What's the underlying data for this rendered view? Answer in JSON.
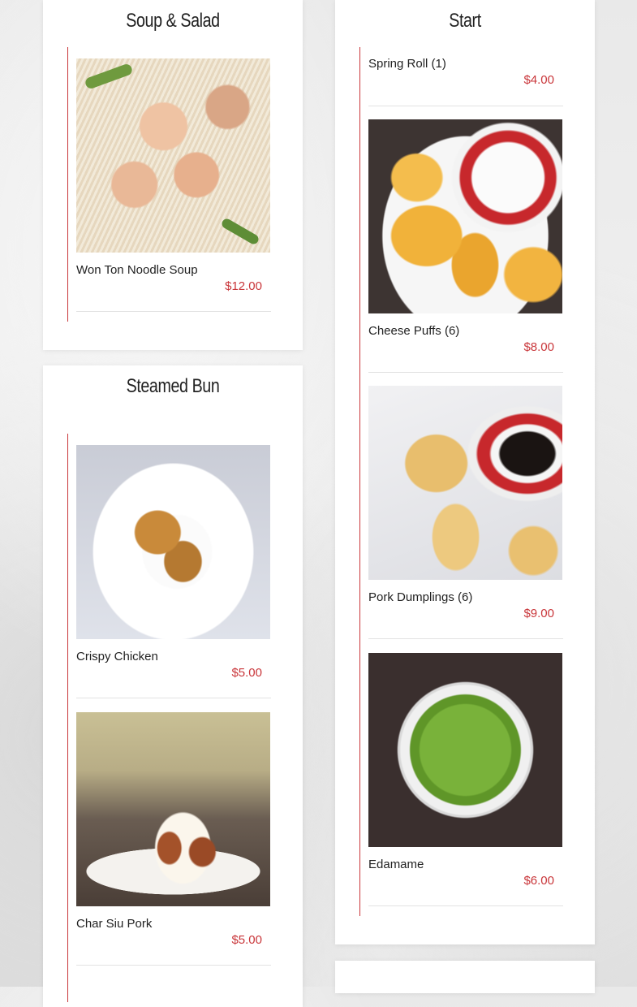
{
  "sections": {
    "soup_salad": {
      "title": "Soup & Salad",
      "items": [
        {
          "name": "Won Ton Noodle Soup",
          "price": "$12.00",
          "photo": "won-ton-noodle-soup-photo"
        }
      ]
    },
    "start": {
      "title": "Start",
      "items": [
        {
          "name": "Spring Roll (1)",
          "price": "$4.00"
        },
        {
          "name": "Cheese Puffs (6)",
          "price": "$8.00",
          "photo": "cheese-puffs-photo"
        },
        {
          "name": "Pork Dumplings (6)",
          "price": "$9.00",
          "photo": "pork-dumplings-photo"
        },
        {
          "name": "Edamame",
          "price": "$6.00",
          "photo": "edamame-photo"
        }
      ]
    },
    "steamed_bun": {
      "title": "Steamed Bun",
      "items": [
        {
          "name": "Crispy Chicken",
          "price": "$5.00",
          "photo": "crispy-chicken-bun-photo"
        },
        {
          "name": "Char Siu Pork",
          "price": "$5.00",
          "photo": "char-siu-pork-bun-photo"
        }
      ]
    }
  },
  "colors": {
    "accent": "#c9363a",
    "card_background": "#ffffff",
    "text": "#222222"
  }
}
